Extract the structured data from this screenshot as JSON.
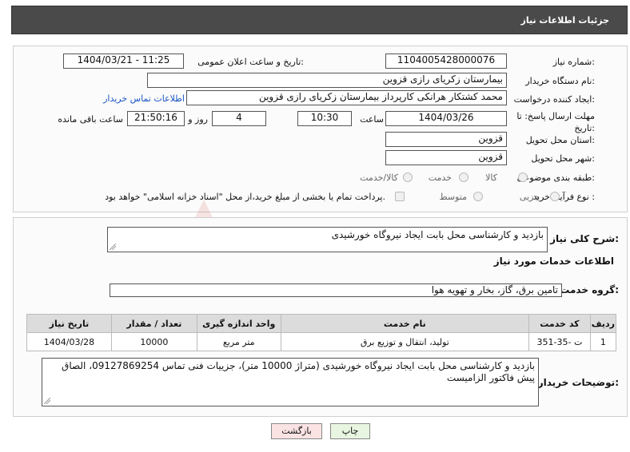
{
  "header": {
    "title": "جزئیات اطلاعات نیاز"
  },
  "form": {
    "need_number_label": "شماره نیاز:",
    "need_number": "1104005428000076",
    "announce_label": "تاریخ و ساعت اعلان عمومی:",
    "announce_value": "1404/03/21 - 11:25",
    "buyer_label": "نام دستگاه خریدار:",
    "buyer_value": "بیمارستان زکریای رازی قزوین",
    "creator_label": "ایجاد کننده درخواست:",
    "creator_value": "محمد کشتکار هرانکی کارپرداز بیمارستان زکریای رازی قزوین",
    "contact_link": "اطلاعات تماس خریدار",
    "deadline_label": "مهلت ارسال پاسخ: تا تاریخ:",
    "deadline_date": "1404/03/26",
    "time_label": "ساعت",
    "deadline_time": "10:30",
    "days_value": "4",
    "days_label": "روز و",
    "remaining_time": "21:50:16",
    "remaining_label": "ساعت باقی مانده",
    "province_label": "استان محل تحویل:",
    "province_value": "قزوین",
    "city_label": "شهر محل تحویل:",
    "city_value": "قزوین",
    "category_label": "طبقه بندی موضوعی:",
    "category_options": [
      "کالا",
      "خدمت",
      "کالا/خدمت"
    ],
    "process_label": "نوع فرآیند خرید :",
    "process_options": [
      "جزیی",
      "متوسط"
    ],
    "payment_note": "پرداخت تمام یا بخشی از مبلغ خرید،از محل \"اسناد خزانه اسلامی\" خواهد بود."
  },
  "summary": {
    "label": "شرح کلی نیاز:",
    "value": "بازدید و کارشناسی محل بابت ایجاد نیروگاه خورشیدی"
  },
  "services": {
    "title": "اطلاعات خدمات مورد نیاز",
    "group_label": "گروه خدمت:",
    "group_value": "تامین برق، گاز، بخار و تهویه هوا",
    "columns": [
      "ردیف",
      "کد خدمت",
      "نام خدمت",
      "واحد اندازه گیری",
      "تعداد / مقدار",
      "تاریخ نیاز"
    ],
    "rows": [
      [
        "1",
        "ت -35-351",
        "تولید، انتقال و توزیع برق",
        "متر مربع",
        "10000",
        "1404/03/28"
      ]
    ]
  },
  "notes": {
    "label": "توضیحات خریدار:",
    "value": "بازدید و کارشناسی محل بابت ایجاد نیروگاه خورشیدی (متراژ 10000 متر)، جزییات فنی تماس 09127869254، الصاق پیش فاکتور الزامیست"
  },
  "buttons": {
    "print": "چاپ",
    "back": "بازگشت"
  },
  "watermark": "AriaTender.neT",
  "colors": {
    "header_bg": "#4a4a4a",
    "link": "#1a55c5",
    "back_btn": "#fbe3e3",
    "print_btn": "#e8f5e0"
  }
}
